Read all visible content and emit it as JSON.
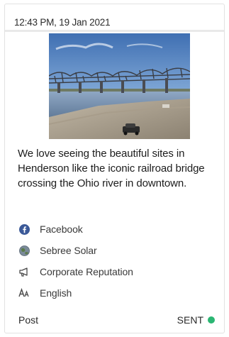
{
  "post": {
    "timestamp": "12:43 PM, 19 Jan 2021",
    "caption": "We love seeing the beautiful sites in Henderson like the iconic railroad bridge crossing the Ohio river in downtown.",
    "network": {
      "label": "Facebook",
      "icon": "facebook-icon"
    },
    "account": {
      "label": "Sebree Solar",
      "icon": "globe-icon"
    },
    "campaign": {
      "label": "Corporate Reputation",
      "icon": "megaphone-icon"
    },
    "language": {
      "label": "English",
      "icon": "language-icon"
    },
    "type": "Post",
    "status": {
      "label": "SENT",
      "color": "#2bb673"
    }
  },
  "colors": {
    "facebook": "#3b5998",
    "card_border": "#e2e2e2"
  }
}
